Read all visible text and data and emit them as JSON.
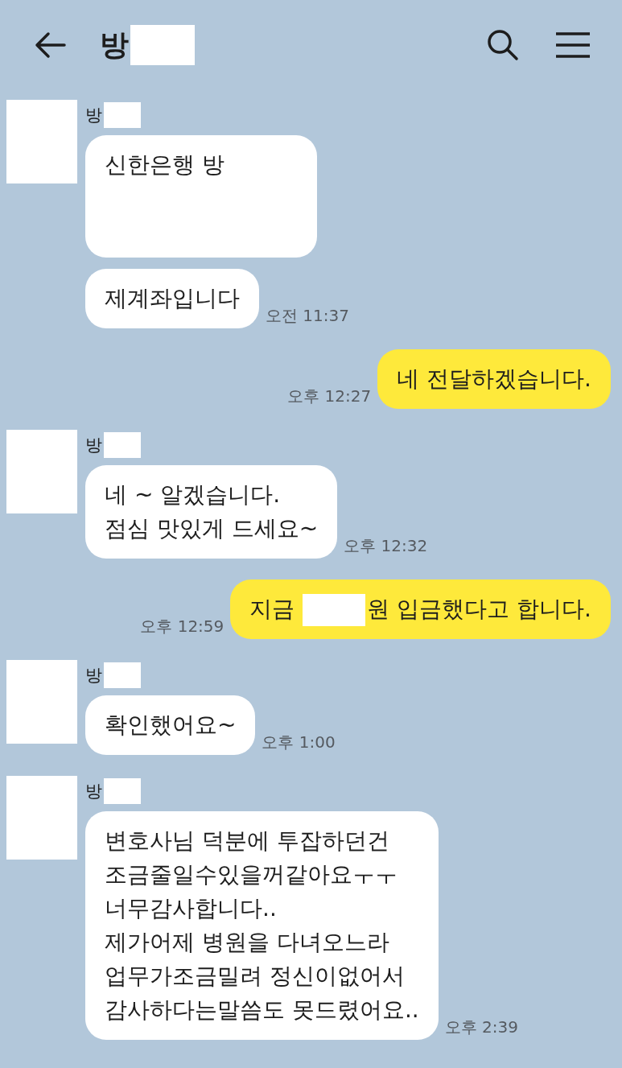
{
  "header": {
    "title": "방"
  },
  "messages": [
    {
      "kind": "received",
      "sender": "방",
      "bubbles": [
        {
          "parts": [
            {
              "kind": "text",
              "text": "신한은행 방"
            },
            {
              "kind": "redacted_block"
            }
          ]
        },
        {
          "parts": [
            {
              "kind": "text",
              "text": "제계좌입니다"
            }
          ]
        }
      ],
      "time": "오전 11:37"
    },
    {
      "kind": "sent",
      "bubbles": [
        {
          "parts": [
            {
              "kind": "text",
              "text": "네 전달하겠습니다."
            }
          ]
        }
      ],
      "time": "오후 12:27"
    },
    {
      "kind": "received",
      "sender": "방",
      "bubbles": [
        {
          "parts": [
            {
              "kind": "text",
              "text": "네 ~ 알겠습니다.\n점심 맛있게 드세요~"
            }
          ]
        }
      ],
      "time": "오후 12:32"
    },
    {
      "kind": "sent",
      "bubbles": [
        {
          "parts": [
            {
              "kind": "text",
              "text": "지금"
            },
            {
              "kind": "redacted"
            },
            {
              "kind": "text",
              "text": "원 입금했다고 합니다."
            }
          ]
        }
      ],
      "time": "오후 12:59"
    },
    {
      "kind": "received",
      "sender": "방",
      "bubbles": [
        {
          "parts": [
            {
              "kind": "text",
              "text": "확인했어요~"
            }
          ]
        }
      ],
      "time": "오후 1:00"
    },
    {
      "kind": "received",
      "sender": "방",
      "bubbles": [
        {
          "parts": [
            {
              "kind": "text",
              "text": "변호사님 덕분에 투잡하던건\n조금줄일수있을꺼같아요ㅜㅜ\n너무감사합니다..\n제가어제 병원을 다녀오느라\n업무가조금밀려 정신이없어서\n감사하다는말씀도 못드렸어요.."
            }
          ]
        }
      ],
      "time": "오후 2:39"
    }
  ]
}
